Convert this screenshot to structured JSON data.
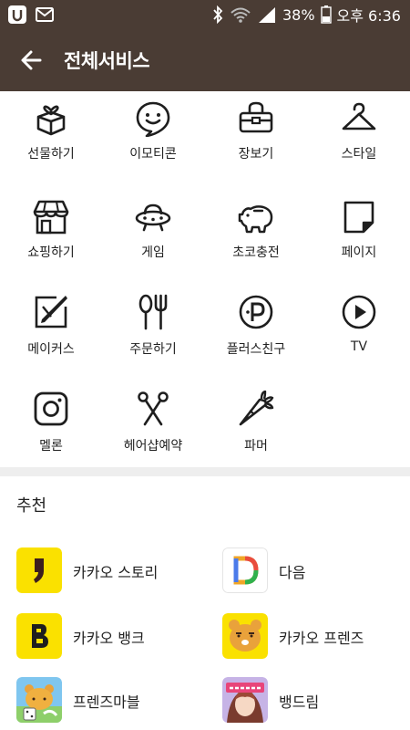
{
  "status_bar": {
    "battery": "38%",
    "time": "오후 6:36",
    "icons": [
      "carrier-icon",
      "mail-icon",
      "bluetooth-icon",
      "wifi-icon",
      "signal-icon",
      "battery-icon"
    ]
  },
  "header": {
    "title": "전체서비스",
    "back_icon": "back-arrow-icon"
  },
  "services": [
    {
      "label": "선물하기",
      "icon": "gift-icon"
    },
    {
      "label": "이모티콘",
      "icon": "emoticon-icon"
    },
    {
      "label": "장보기",
      "icon": "shopping-bag-icon"
    },
    {
      "label": "스타일",
      "icon": "hanger-icon"
    },
    {
      "label": "쇼핑하기",
      "icon": "store-icon"
    },
    {
      "label": "게임",
      "icon": "ufo-icon"
    },
    {
      "label": "초코충전",
      "icon": "piggy-bank-icon"
    },
    {
      "label": "페이지",
      "icon": "page-icon"
    },
    {
      "label": "메이커스",
      "icon": "makers-icon"
    },
    {
      "label": "주문하기",
      "icon": "fork-spoon-icon"
    },
    {
      "label": "플러스친구",
      "icon": "plus-friend-icon"
    },
    {
      "label": "TV",
      "icon": "play-icon"
    },
    {
      "label": "멜론",
      "icon": "melon-icon"
    },
    {
      "label": "헤어샵예약",
      "icon": "scissors-icon"
    },
    {
      "label": "파머",
      "icon": "carrot-icon"
    }
  ],
  "recommend": {
    "title": "추천",
    "items": [
      {
        "label": "카카오 스토리",
        "icon": "kakao-story-icon"
      },
      {
        "label": "다음",
        "icon": "daum-icon"
      },
      {
        "label": "카카오 뱅크",
        "icon": "kakao-bank-icon"
      },
      {
        "label": "카카오 프렌즈",
        "icon": "kakao-friends-icon"
      },
      {
        "label": "프렌즈마블",
        "icon": "friends-marble-icon"
      },
      {
        "label": "뱅드림",
        "icon": "bang-dream-icon"
      }
    ]
  },
  "colors": {
    "header_bg": "#4a3c34",
    "kakao_yellow": "#fae100",
    "divider": "#eeeeee"
  }
}
